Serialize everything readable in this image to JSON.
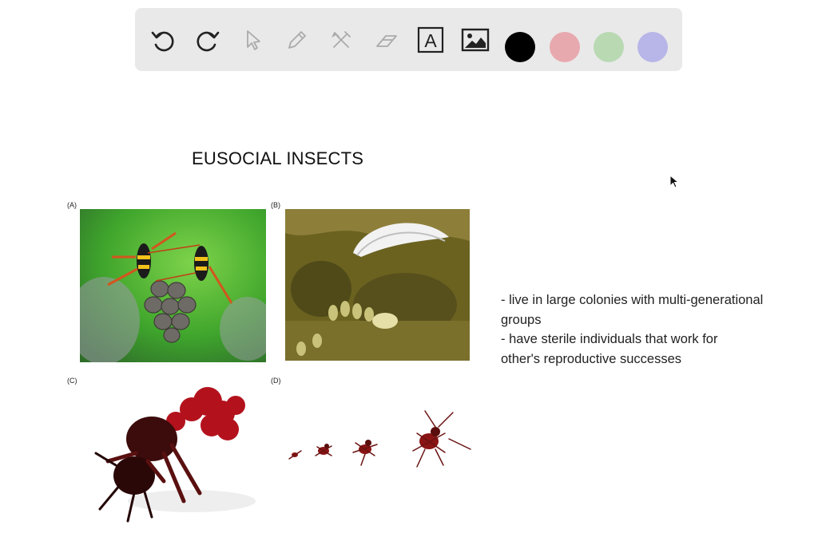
{
  "toolbar": {
    "tools": [
      {
        "name": "undo-icon"
      },
      {
        "name": "redo-icon"
      },
      {
        "name": "select-pointer-icon"
      },
      {
        "name": "pencil-icon"
      },
      {
        "name": "tools-icon"
      },
      {
        "name": "eraser-icon"
      },
      {
        "name": "text-tool-icon",
        "glyph": "A"
      },
      {
        "name": "image-tool-icon"
      }
    ],
    "colors": [
      "#000000",
      "#e8a9ae",
      "#b9d9b3",
      "#b8b5e8"
    ]
  },
  "canvas": {
    "title": "EUSOCIAL INSECTS",
    "panels": [
      {
        "label": "(A)",
        "icon": "wasps-on-nest-photo"
      },
      {
        "label": "(B)",
        "icon": "termite-nest-photo"
      },
      {
        "label": "(C)",
        "icon": "leafcutter-ant-head-photo"
      },
      {
        "label": "(D)",
        "icon": "ant-castes-photo"
      }
    ],
    "notes": [
      "- live in large colonies with multi-generational",
      "groups",
      "- have sterile individuals that work for",
      "other's reproductive successes"
    ]
  }
}
